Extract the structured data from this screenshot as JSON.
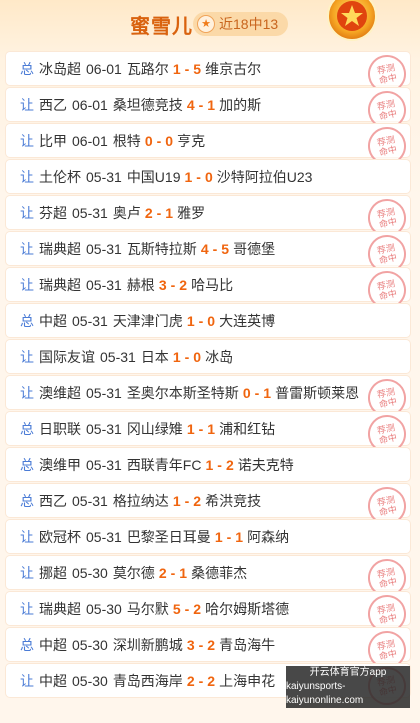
{
  "header": {
    "title": "蜜雪儿",
    "badge": "近18中13",
    "badge_icon": "star-icon"
  },
  "rows": [
    {
      "type": "总",
      "league": "冰岛超",
      "date": "06-01",
      "home": "瓦路尔",
      "hs": "1",
      "as": "5",
      "away": "维京古尔",
      "stamp": true
    },
    {
      "type": "让",
      "league": "西乙",
      "date": "06-01",
      "home": "桑坦德竞技",
      "hs": "4",
      "as": "1",
      "away": "加的斯",
      "stamp": true
    },
    {
      "type": "让",
      "league": "比甲",
      "date": "06-01",
      "home": "根特",
      "hs": "0",
      "as": "0",
      "away": "亨克",
      "stamp": true
    },
    {
      "type": "让",
      "league": "土伦杯",
      "date": "05-31",
      "home": "中国U19",
      "hs": "1",
      "as": "0",
      "away": "沙特阿拉伯U23",
      "stamp": false
    },
    {
      "type": "让",
      "league": "芬超",
      "date": "05-31",
      "home": "奥卢",
      "hs": "2",
      "as": "1",
      "away": "雅罗",
      "stamp": true
    },
    {
      "type": "让",
      "league": "瑞典超",
      "date": "05-31",
      "home": "瓦斯特拉斯",
      "hs": "4",
      "as": "5",
      "away": "哥德堡",
      "stamp": true
    },
    {
      "type": "让",
      "league": "瑞典超",
      "date": "05-31",
      "home": "赫根",
      "hs": "3",
      "as": "2",
      "away": "哈马比",
      "stamp": true
    },
    {
      "type": "总",
      "league": "中超",
      "date": "05-31",
      "home": "天津津门虎",
      "hs": "1",
      "as": "0",
      "away": "大连英博",
      "stamp": false
    },
    {
      "type": "让",
      "league": "国际友谊",
      "date": "05-31",
      "home": "日本",
      "hs": "1",
      "as": "0",
      "away": "冰岛",
      "stamp": false
    },
    {
      "type": "让",
      "league": "澳维超",
      "date": "05-31",
      "home": "圣奥尔本斯圣特斯",
      "hs": "0",
      "as": "1",
      "away": "普雷斯顿莱恩",
      "stamp": true
    },
    {
      "type": "总",
      "league": "日职联",
      "date": "05-31",
      "home": "冈山绿雉",
      "hs": "1",
      "as": "1",
      "away": "浦和红钻",
      "stamp": true
    },
    {
      "type": "总",
      "league": "澳维甲",
      "date": "05-31",
      "home": "西联青年FC",
      "hs": "1",
      "as": "2",
      "away": "诺夫克特",
      "stamp": false
    },
    {
      "type": "总",
      "league": "西乙",
      "date": "05-31",
      "home": "格拉纳达",
      "hs": "1",
      "as": "2",
      "away": "希洪竞技",
      "stamp": true
    },
    {
      "type": "让",
      "league": "欧冠杯",
      "date": "05-31",
      "home": "巴黎圣日耳曼",
      "hs": "1",
      "as": "1",
      "away": "阿森纳",
      "stamp": false
    },
    {
      "type": "让",
      "league": "挪超",
      "date": "05-30",
      "home": "莫尔德",
      "hs": "2",
      "as": "1",
      "away": "桑德菲杰",
      "stamp": true
    },
    {
      "type": "让",
      "league": "瑞典超",
      "date": "05-30",
      "home": "马尔默",
      "hs": "5",
      "as": "2",
      "away": "哈尔姆斯塔德",
      "stamp": true
    },
    {
      "type": "总",
      "league": "中超",
      "date": "05-30",
      "home": "深圳新鹏城",
      "hs": "3",
      "as": "2",
      "away": "青岛海牛",
      "stamp": true
    },
    {
      "type": "让",
      "league": "中超",
      "date": "05-30",
      "home": "青岛西海岸",
      "hs": "2",
      "as": "2",
      "away": "上海申花",
      "stamp": true
    }
  ],
  "stamp_text": [
    "荐",
    "测",
    "命中"
  ],
  "watermark": {
    "line1": "开云体育官方app",
    "line2": "kaiyunsports-kaiyunonline.com"
  }
}
